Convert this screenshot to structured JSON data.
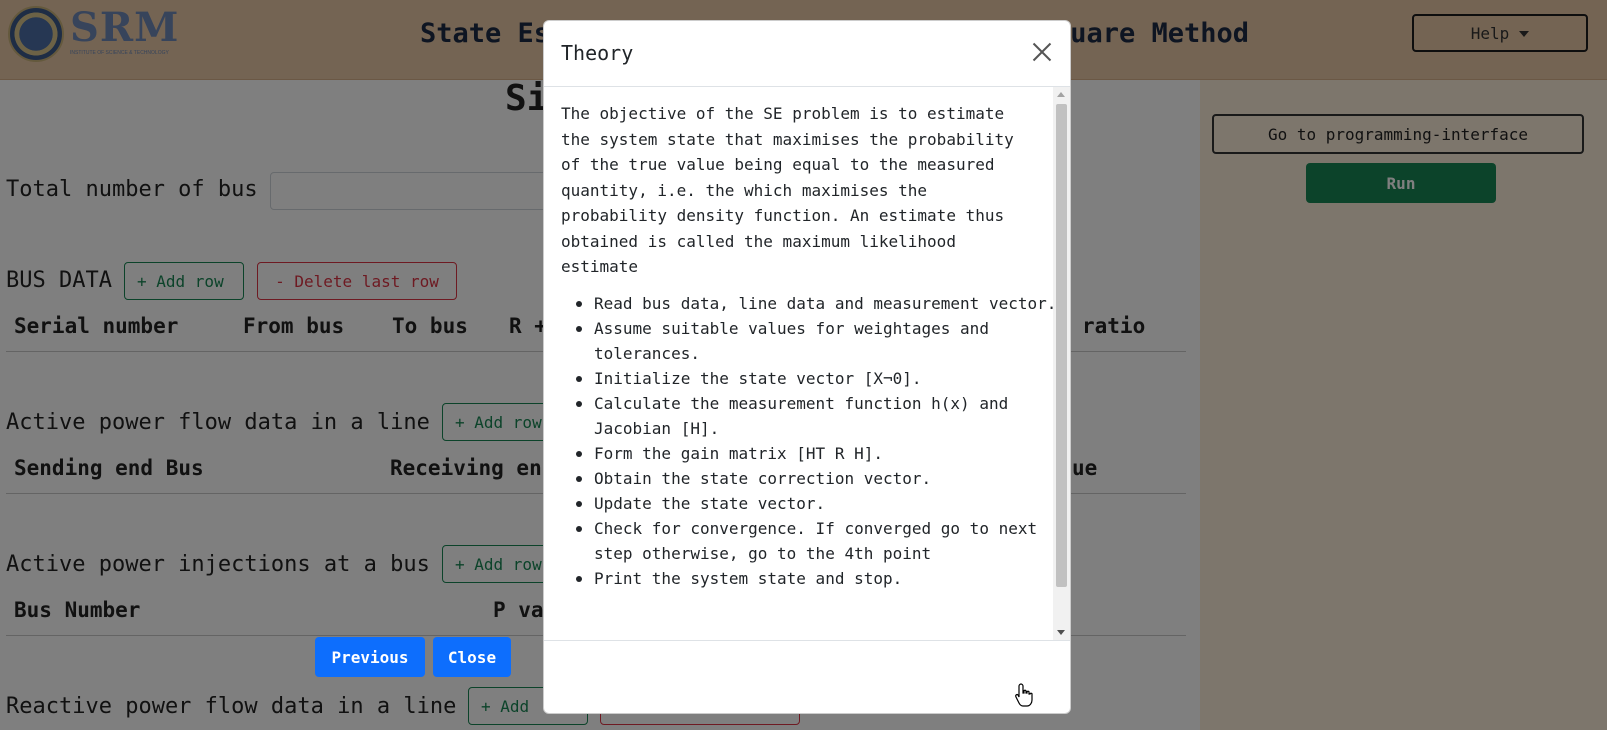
{
  "app": {
    "logo_text": "SRM",
    "logo_subtitle": "INSTITUTE OF SCIENCE & TECHNOLOGY",
    "nav_title": "State Estimation using Weighted Least Square Method",
    "help_label": "Help"
  },
  "sidebar": {
    "goto_label": "Go to programming-interface",
    "run_label": "Run"
  },
  "page": {
    "heading": "Si",
    "total_bus_label": "Total number of bus",
    "bus_data_label": "BUS DATA",
    "add_row_label": "+ Add row",
    "delete_last_row_label": "- Delete last row",
    "bus_table_headers": [
      "Serial number",
      "From bus",
      "To bus",
      "R +",
      "ratio"
    ],
    "active_flow_label": "Active power flow data in a line",
    "flow_table_headers": [
      "Sending end Bus",
      "Receiving en",
      "ue"
    ],
    "active_injection_label": "Active power injections at a bus",
    "injection_table_headers": [
      "Bus Number",
      "P va"
    ],
    "reactive_flow_label": "Reactive power flow data in a line",
    "add_row_truncated_1": "+ Add row",
    "add_row_truncated_2": "+ Add row",
    "add_row_truncated_3": "+ Add"
  },
  "modal": {
    "title": "Theory",
    "intro": "The objective of the SE problem is to estimate the system state that maximises the probability of the true value being equal to the measured quantity, i.e. the which maximises the probability density function. An estimate thus obtained is called the maximum likelihood estimate",
    "steps": [
      "Read bus data, line data and measurement vector.",
      "Assume suitable values for weightages and tolerances.",
      "Initialize the state vector [X¬0].",
      "Calculate the measurement function h(x) and Jacobian [H].",
      "Form the gain matrix [HT R H].",
      "Obtain the state correction vector.",
      "Update the state vector.",
      "Check for convergence. If converged go to next step otherwise, go to the 4th point",
      "Print the system state and stop."
    ],
    "previous_label": "Previous",
    "close_label": "Close"
  },
  "icons": {
    "close": "close-icon",
    "caret": "chevron-down-icon",
    "cursor": "hand-pointer-icon"
  },
  "colors": {
    "navbar": "#e8c9a6",
    "sidebar": "#fbecd9",
    "run": "#198754",
    "primary": "#0d6efd",
    "danger": "#dc3545"
  }
}
